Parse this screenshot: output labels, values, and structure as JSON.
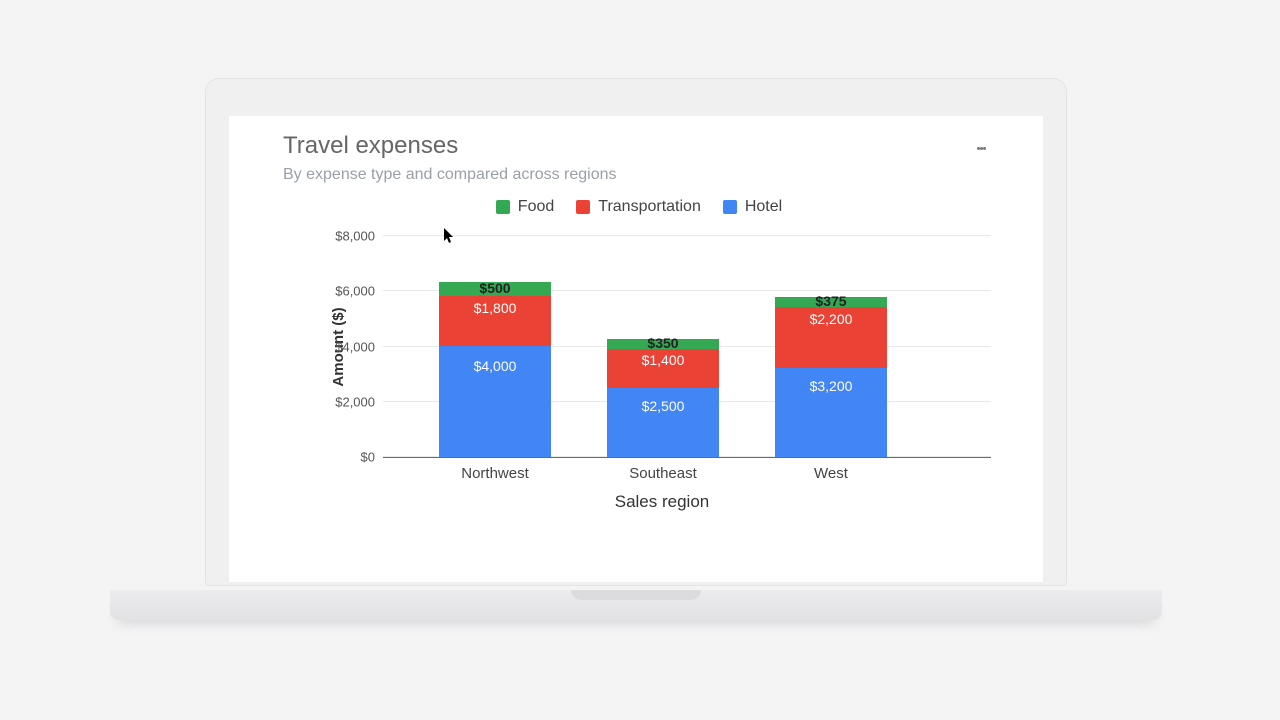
{
  "title": "Travel expenses",
  "subtitle": "By expense type and compared across regions",
  "legend": {
    "food": "Food",
    "transportation": "Transportation",
    "hotel": "Hotel"
  },
  "ylabel": "Amount ($)",
  "xlabel": "Sales region",
  "yticks": [
    "$0",
    "$2,000",
    "$4,000",
    "$6,000",
    "$8,000"
  ],
  "categories": [
    "Northwest",
    "Southeast",
    "West"
  ],
  "labels": {
    "nw_hotel": "$4,000",
    "nw_trans": "$1,800",
    "nw_food": "$500",
    "se_hotel": "$2,500",
    "se_trans": "$1,400",
    "se_food": "$350",
    "w_hotel": "$3,200",
    "w_trans": "$2,200",
    "w_food": "$375"
  },
  "colors": {
    "food": "#34a853",
    "transportation": "#ea4335",
    "hotel": "#4285f4"
  },
  "chart_data": {
    "type": "bar",
    "stacked": true,
    "title": "Travel expenses",
    "subtitle": "By expense type and compared across regions",
    "xlabel": "Sales region",
    "ylabel": "Amount ($)",
    "ylim": [
      0,
      8000
    ],
    "yticks": [
      0,
      2000,
      4000,
      6000,
      8000
    ],
    "categories": [
      "Northwest",
      "Southeast",
      "West"
    ],
    "series": [
      {
        "name": "Hotel",
        "color": "#4285f4",
        "values": [
          4000,
          2500,
          3200
        ]
      },
      {
        "name": "Transportation",
        "color": "#ea4335",
        "values": [
          1800,
          1400,
          2200
        ]
      },
      {
        "name": "Food",
        "color": "#34a853",
        "values": [
          500,
          350,
          375
        ]
      }
    ],
    "legend_position": "top"
  }
}
